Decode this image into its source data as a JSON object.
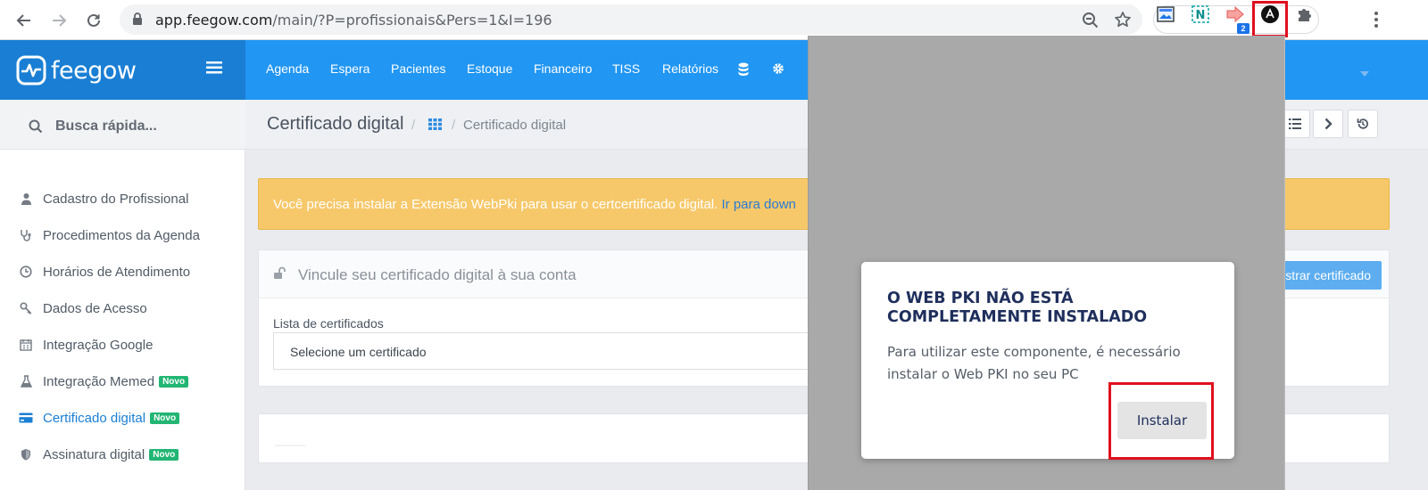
{
  "browser": {
    "url_host": "app.feegow.com",
    "url_path": "/main/?P=profissionais&Pers=1&I=196",
    "ext_badge": "2",
    "ext_logo_letter": "N"
  },
  "app": {
    "brand": "feegow",
    "nav": [
      "Agenda",
      "Espera",
      "Pacientes",
      "Estoque",
      "Financeiro",
      "TISS",
      "Relatórios"
    ]
  },
  "sidebar": {
    "search_placeholder": "Busca rápida...",
    "items": [
      {
        "label": "Cadastro do Profissional",
        "icon": "user-icon",
        "badge": ""
      },
      {
        "label": "Procedimentos da Agenda",
        "icon": "stethoscope-icon",
        "badge": ""
      },
      {
        "label": "Horários de Atendimento",
        "icon": "clock-icon",
        "badge": ""
      },
      {
        "label": "Dados de Acesso",
        "icon": "key-icon",
        "badge": ""
      },
      {
        "label": "Integração Google",
        "icon": "calendar-icon",
        "badge": ""
      },
      {
        "label": "Integração Memed",
        "icon": "flask-icon",
        "badge": "Novo"
      },
      {
        "label": "Certificado digital",
        "icon": "credit-card-icon",
        "badge": "Novo"
      },
      {
        "label": "Assinatura digital",
        "icon": "shield-icon",
        "badge": "Novo"
      }
    ]
  },
  "page": {
    "title": "Certificado digital",
    "breadcrumb": "Certificado digital",
    "alert_text": "Você precisa instalar a Extensão WebPki para usar o certcertificado digital.",
    "alert_link": "Ir para down",
    "panel_title": "Vincule seu certificado digital à sua conta",
    "register_button": "gistrar certificado",
    "list_label": "Lista de certificados",
    "select_value": "Selecione um certificado"
  },
  "popup": {
    "title": "O WEB PKI NÃO ESTÁ COMPLETAMENTE INSTALADO",
    "text": "Para utilizar este componente, é necessário instalar o Web PKI no seu PC",
    "install_button": "Instalar"
  },
  "colors": {
    "brand_dark": "#1a7fd4",
    "brand": "#2196f3",
    "alert": "#f6c86a",
    "badge_green": "#22b573",
    "highlight_red": "#e0101e"
  }
}
